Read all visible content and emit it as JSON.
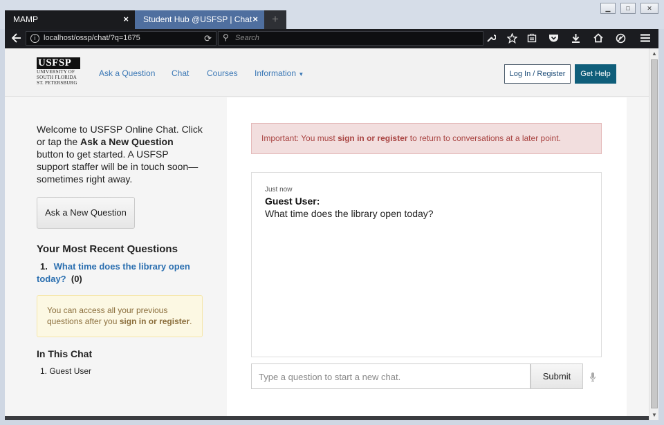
{
  "browser": {
    "tabs": [
      {
        "label": "MAMP",
        "close": "×"
      },
      {
        "label": "Student Hub @USFSP | Chat",
        "close": "×"
      }
    ],
    "new_tab_symbol": "+",
    "window_buttons": {
      "minimize": "▁",
      "maximize": "□",
      "close": "✕"
    },
    "url": "localhost/ossp/chat/?q=1675",
    "search_placeholder": "Search",
    "icons": [
      "back-icon",
      "info-icon",
      "reload-icon",
      "search-icon",
      "wrench-icon",
      "star-icon",
      "reading-list-icon",
      "pocket-icon",
      "download-icon",
      "home-icon",
      "addon-icon",
      "hamburger-menu-icon"
    ]
  },
  "site": {
    "logo": {
      "mark": "USFSP",
      "lines": [
        "UNIVERSITY OF",
        "SOUTH FLORIDA",
        "ST. PETERSBURG"
      ]
    },
    "nav": {
      "ask": "Ask a Question",
      "chat": "Chat",
      "courses": "Courses",
      "information": "Information"
    },
    "login_label": "Log In / Register",
    "help_label": "Get Help"
  },
  "sidebar": {
    "intro_part1": "Welcome to USFSP Online Chat. Click or tap the ",
    "intro_bold": "Ask a New Question",
    "intro_part2": " button to get started. A USFSP support staffer will be in touch soon—sometimes right away.",
    "ask_button": "Ask a New Question",
    "recent_heading": "Your Most Recent Questions",
    "recent": [
      {
        "num": "1.",
        "question": "What time does the library open today?",
        "count": "(0)"
      }
    ],
    "notice_text": "You can access all your previous questions after you ",
    "notice_link": "sign in or register",
    "notice_end": ".",
    "in_chat_heading": "In This Chat",
    "participants": [
      "1. Guest User"
    ]
  },
  "main": {
    "alert_prefix": "Important: You must ",
    "alert_link": "sign in or register",
    "alert_suffix": " to return to conversations at a later point.",
    "messages": [
      {
        "time": "Just now",
        "user": "Guest User:",
        "text": "What time does the library open today?"
      }
    ],
    "input_placeholder": "Type a question to start a new chat.",
    "submit_label": "Submit"
  },
  "colors": {
    "link": "#2b6fb0",
    "help_button": "#0f5e7a",
    "alert_bg": "#f2dede",
    "alert_text": "#a94442",
    "notice_bg": "#fcf8e3",
    "notice_text": "#8a6d3b",
    "active_tab": "#4f6f9f"
  }
}
